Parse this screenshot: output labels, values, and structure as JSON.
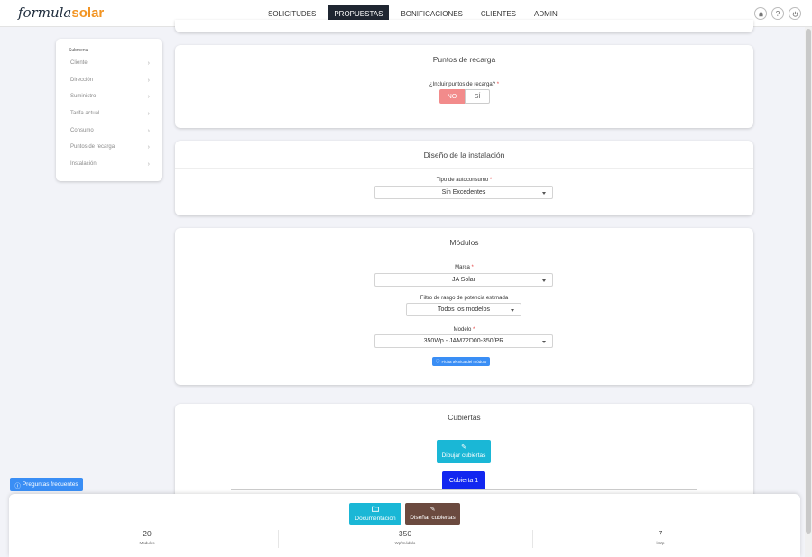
{
  "app": {
    "logo_main": "formula",
    "logo_accent": "solar"
  },
  "nav": {
    "items": [
      {
        "label": "SOLICITUDES",
        "active": false,
        "has_caret": true
      },
      {
        "label": "PROPUESTAS",
        "active": true,
        "has_caret": true
      },
      {
        "label": "BONIFICACIONES",
        "active": false,
        "has_caret": false
      },
      {
        "label": "CLIENTES",
        "active": false,
        "has_caret": false
      },
      {
        "label": "ADMIN",
        "active": false,
        "has_caret": true
      }
    ],
    "icons": [
      "home-icon",
      "help-icon",
      "power-icon"
    ]
  },
  "submenu": {
    "title": "Submenu",
    "items": [
      {
        "label": "Cliente"
      },
      {
        "label": "Dirección"
      },
      {
        "label": "Suministro"
      },
      {
        "label": "Tarifa actual"
      },
      {
        "label": "Consumo"
      },
      {
        "label": "Puntos de recarga"
      },
      {
        "label": "Instalación"
      }
    ]
  },
  "recarga": {
    "title": "Puntos de recarga",
    "question": "¿Incluir puntos de recarga?",
    "required": "*",
    "no": "NO",
    "si": "SÍ",
    "selected": "NO"
  },
  "diseno": {
    "title": "Diseño de la instalación",
    "tipo_label": "Tipo de autoconsumo",
    "required": "*",
    "tipo_value": "Sin Excedentes"
  },
  "modulos": {
    "title": "Módulos",
    "marca_label": "Marca",
    "marca_value": "JA Solar",
    "filtro_label": "Filtro de rango de potencia estimada",
    "filtro_value": "Todos los modelos",
    "modelo_label": "Modelo",
    "modelo_value": "350Wp - JAM72D00-350/PR",
    "required": "*",
    "ficha_label": "Ficha técnica del módulo"
  },
  "cubiertas": {
    "title": "Cubiertas",
    "dibujar_label": "Dibujar cubiertas",
    "tab_label": "Cubierta 1"
  },
  "faq": {
    "label": "Preguntas frecuentes"
  },
  "bottom": {
    "doc_label": "Documentación",
    "disenar_label": "Diseñar cubiertas",
    "stats": [
      {
        "value": "20",
        "unit": "Modulos"
      },
      {
        "value": "350",
        "unit": "Wp/módulo"
      },
      {
        "value": "7",
        "unit": "kWp"
      }
    ]
  },
  "colors": {
    "nav_active": "#1f2631",
    "accent_orange": "#f29422",
    "primary_blue": "#3a8ef5",
    "cyan": "#1ab7d6",
    "toggle_no": "#f28b8b",
    "tab_blue": "#1227f0",
    "brown": "#6b4a3f"
  }
}
